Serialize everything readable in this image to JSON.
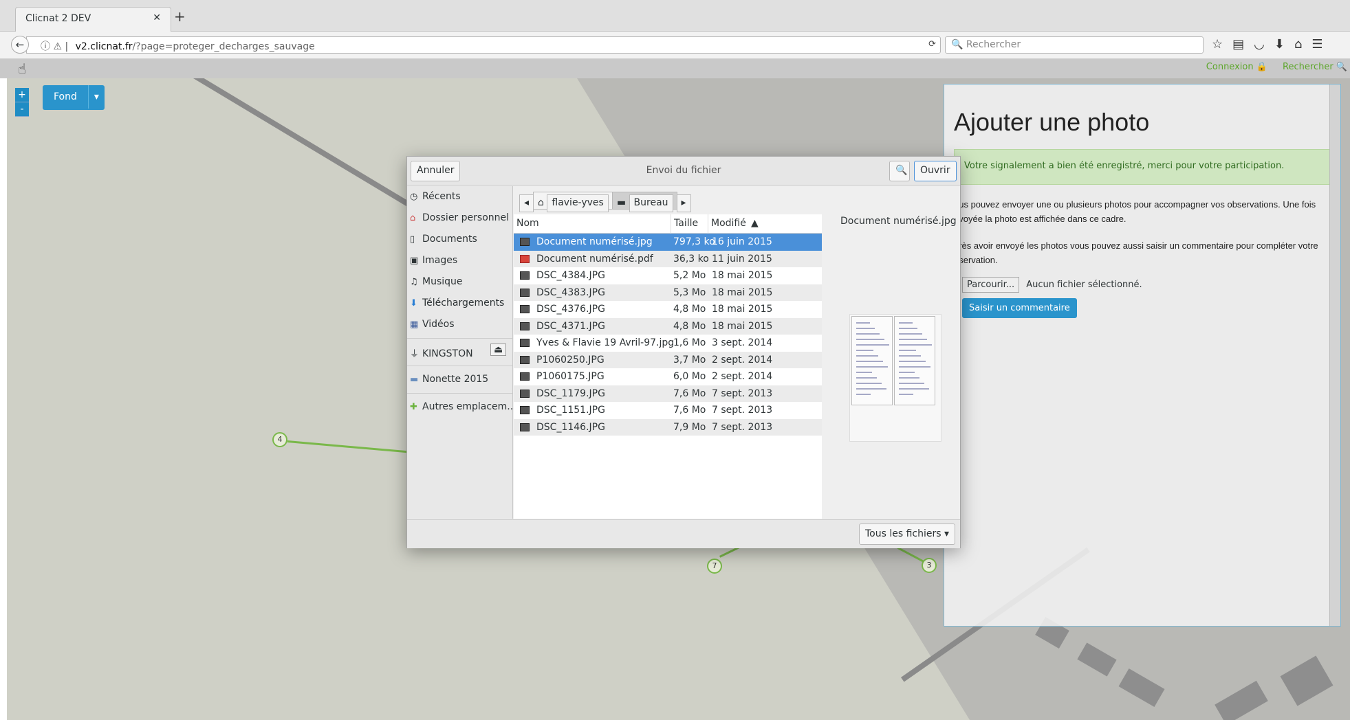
{
  "browser": {
    "tab_title": "Clicnat 2 DEV",
    "url_domain": "v2.clicnat.fr",
    "url_path": "/?page=proteger_decharges_sauvage",
    "search_placeholder": "Rechercher"
  },
  "site": {
    "links": [
      "Connexion 🔒",
      "Rechercher 🔍"
    ],
    "fond_label": "Fond",
    "zoom_in": "+",
    "zoom_out": "-",
    "markers": [
      "4",
      "7",
      "3"
    ]
  },
  "panel": {
    "title": "Ajouter une photo",
    "alert": "Votre signalement a bien été enregistré, merci pour votre participation.",
    "p1": "ous pouvez envoyer une ou plusieurs photos pour accompagner vos observations. Une fois nvoyée la photo est affichée dans ce cadre.",
    "p2": "près avoir envoyé les photos vous pouvez aussi saisir un commentaire pour compléter votre bservation.",
    "browse_label": "Parcourir...",
    "no_file": "Aucun fichier sélectionné.",
    "comment_button": "Saisir un commentaire"
  },
  "dialog": {
    "title": "Envoi du fichier",
    "cancel_label": "Annuler",
    "open_label": "Ouvrir",
    "sidebar": [
      "Récents",
      "Dossier personnel",
      "Documents",
      "Images",
      "Musique",
      "Téléchargements",
      "Vidéos",
      "KINGSTON",
      "Nonette 2015",
      "Autres emplacem..."
    ],
    "crumbs": [
      "flavie-yves",
      "Bureau"
    ],
    "columns": {
      "name": "Nom",
      "size": "Taille",
      "modified": "Modifié"
    },
    "files": [
      {
        "name": "Document numérisé.jpg",
        "size": "797,3 ko",
        "date": "16 juin 2015"
      },
      {
        "name": "Document numérisé.pdf",
        "size": "36,3 ko",
        "date": "11 juin 2015"
      },
      {
        "name": "DSC_4384.JPG",
        "size": "5,2 Mo",
        "date": "18 mai 2015"
      },
      {
        "name": "DSC_4383.JPG",
        "size": "5,3 Mo",
        "date": "18 mai 2015"
      },
      {
        "name": "DSC_4376.JPG",
        "size": "4,8 Mo",
        "date": "18 mai 2015"
      },
      {
        "name": "DSC_4371.JPG",
        "size": "4,8 Mo",
        "date": "18 mai 2015"
      },
      {
        "name": "Yves & Flavie 19 Avril-97.jpg",
        "size": "1,6 Mo",
        "date": "3 sept. 2014"
      },
      {
        "name": "P1060250.JPG",
        "size": "3,7 Mo",
        "date": "2 sept. 2014"
      },
      {
        "name": "P1060175.JPG",
        "size": "6,0 Mo",
        "date": "2 sept. 2014"
      },
      {
        "name": "DSC_1179.JPG",
        "size": "7,6 Mo",
        "date": "7 sept. 2013"
      },
      {
        "name": "DSC_1151.JPG",
        "size": "7,6 Mo",
        "date": "7 sept. 2013"
      },
      {
        "name": "DSC_1146.JPG",
        "size": "7,9 Mo",
        "date": "7 sept. 2013"
      }
    ],
    "preview_name": "Document numérisé.jpg",
    "filter_label": "Tous les fichiers"
  }
}
